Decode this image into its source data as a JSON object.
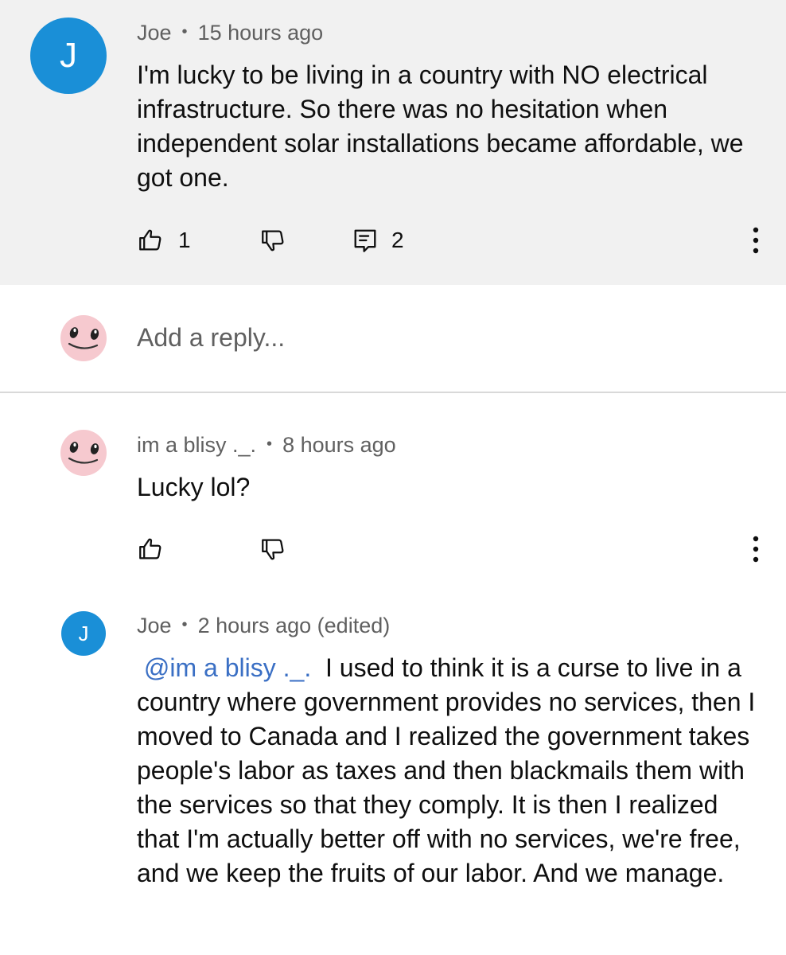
{
  "comment": {
    "avatar_letter": "J",
    "author": "Joe",
    "time": "15 hours ago",
    "text": "I'm lucky to be living in a country with NO electrical infrastructure. So there was no hesitation when independent solar installations became affordable, we got one.",
    "like_count": "1",
    "reply_count": "2"
  },
  "reply_box": {
    "placeholder": "Add a reply..."
  },
  "replies": [
    {
      "author": "im a blisy ._.",
      "time": "8 hours ago",
      "text": "Lucky lol?"
    },
    {
      "avatar_letter": "J",
      "author": "Joe",
      "time": "2 hours ago (edited)",
      "mention": "@im a blisy ._.",
      "text": "I used to think it is a curse to live in a country where government provides no services, then I moved to Canada and I realized the government takes people's labor as taxes and then blackmails them with the services so that they comply. It is then I realized that I'm actually better off with no services, we're free, and we keep the fruits of our labor. And we manage."
    }
  ],
  "separator": "•",
  "colors": {
    "avatar_blue": "#1a8fd7",
    "highlight_bg": "#f1f1f1",
    "mention_blue": "#3a6fc4",
    "smiley_pink": "#f6c9cf"
  },
  "icons": [
    "thumbs-up-icon",
    "thumbs-down-icon",
    "comment-icon",
    "more-vert-icon",
    "smiley-avatar"
  ]
}
